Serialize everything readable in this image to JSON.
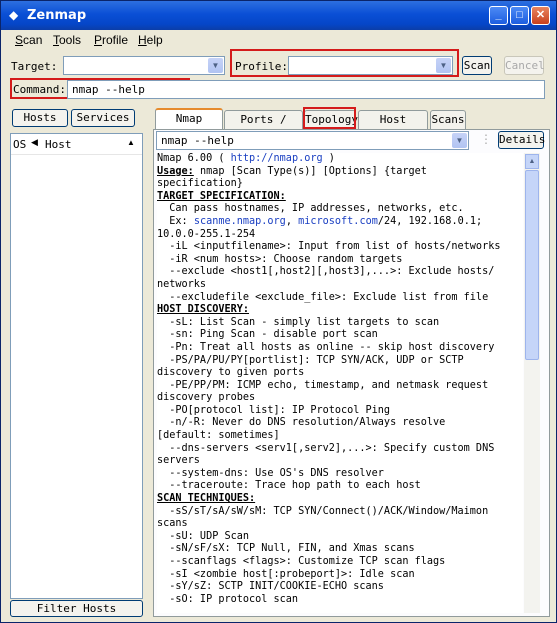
{
  "window": {
    "title": "Zenmap"
  },
  "menu": [
    {
      "label": "Scan",
      "u": "S"
    },
    {
      "label": "Tools",
      "u": "T"
    },
    {
      "label": "Profile",
      "u": "P"
    },
    {
      "label": "Help",
      "u": "H"
    }
  ],
  "toolbar": {
    "target_label": "Target:",
    "target_value": "",
    "profile_label": "Profile:",
    "profile_value": "",
    "scan_label": "Scan",
    "cancel_label": "Cancel",
    "command_label": "Command:",
    "command_value": "nmap --help"
  },
  "left": {
    "hosts_tab": "Hosts",
    "services_tab": "Services",
    "col_os": "OS",
    "col_host": "Host",
    "filter_button": "Filter Hosts"
  },
  "tabs": [
    "Nmap Output",
    "Ports / Hosts",
    "Topology",
    "Host Details",
    "Scans"
  ],
  "output_panel": {
    "selector_value": "nmap --help",
    "details_label": "Details"
  },
  "output_lines": [
    {
      "segs": [
        {
          "t": "Nmap 6.00 ( "
        },
        {
          "t": "http://nmap.org",
          "c": "url"
        },
        {
          "t": " )"
        }
      ]
    },
    {
      "segs": [
        {
          "t": "Usage:",
          "c": "hdr"
        },
        {
          "t": " nmap [Scan Type(s)] [Options] {target"
        }
      ]
    },
    {
      "segs": [
        {
          "t": "specification}"
        }
      ]
    },
    {
      "segs": [
        {
          "t": "TARGET SPECIFICATION:",
          "c": "hdr"
        }
      ]
    },
    {
      "segs": [
        {
          "t": "  Can pass hostnames, IP addresses, networks, etc."
        }
      ]
    },
    {
      "segs": [
        {
          "t": "  Ex: "
        },
        {
          "t": "scanme.nmap.org",
          "c": "url"
        },
        {
          "t": ", "
        },
        {
          "t": "microsoft.com",
          "c": "url"
        },
        {
          "t": "/24, 192.168.0.1;"
        }
      ]
    },
    {
      "segs": [
        {
          "t": "10.0.0-255.1-254"
        }
      ]
    },
    {
      "segs": [
        {
          "t": "  -iL <inputfilename>: Input from list of hosts/networks"
        }
      ]
    },
    {
      "segs": [
        {
          "t": "  -iR <num hosts>: Choose random targets"
        }
      ]
    },
    {
      "segs": [
        {
          "t": "  --exclude <host1[,host2][,host3],...>: Exclude hosts/"
        }
      ]
    },
    {
      "segs": [
        {
          "t": "networks"
        }
      ]
    },
    {
      "segs": [
        {
          "t": "  --excludefile <exclude_file>: Exclude list from file"
        }
      ]
    },
    {
      "segs": [
        {
          "t": "HOST DISCOVERY:",
          "c": "hdr"
        }
      ]
    },
    {
      "segs": [
        {
          "t": "  -sL: List Scan - simply list targets to scan"
        }
      ]
    },
    {
      "segs": [
        {
          "t": "  -sn: Ping Scan - disable port scan"
        }
      ]
    },
    {
      "segs": [
        {
          "t": "  -Pn: Treat all hosts as online -- skip host discovery"
        }
      ]
    },
    {
      "segs": [
        {
          "t": "  -PS/PA/PU/PY[portlist]: TCP SYN/ACK, UDP or SCTP"
        }
      ]
    },
    {
      "segs": [
        {
          "t": "discovery to given ports"
        }
      ]
    },
    {
      "segs": [
        {
          "t": "  -PE/PP/PM: ICMP echo, timestamp, and netmask request"
        }
      ]
    },
    {
      "segs": [
        {
          "t": "discovery probes"
        }
      ]
    },
    {
      "segs": [
        {
          "t": "  -PO[protocol list]: IP Protocol Ping"
        }
      ]
    },
    {
      "segs": [
        {
          "t": "  -n/-R: Never do DNS resolution/Always resolve"
        }
      ]
    },
    {
      "segs": [
        {
          "t": "[default: sometimes]"
        }
      ]
    },
    {
      "segs": [
        {
          "t": "  --dns-servers <serv1[,serv2],...>: Specify custom DNS"
        }
      ]
    },
    {
      "segs": [
        {
          "t": "servers"
        }
      ]
    },
    {
      "segs": [
        {
          "t": "  --system-dns: Use OS's DNS resolver"
        }
      ]
    },
    {
      "segs": [
        {
          "t": "  --traceroute: Trace hop path to each host"
        }
      ]
    },
    {
      "segs": [
        {
          "t": "SCAN TECHNIQUES:",
          "c": "hdr"
        }
      ]
    },
    {
      "segs": [
        {
          "t": "  -sS/sT/sA/sW/sM: TCP SYN/Connect()/ACK/Window/Maimon"
        }
      ]
    },
    {
      "segs": [
        {
          "t": "scans"
        }
      ]
    },
    {
      "segs": [
        {
          "t": "  -sU: UDP Scan"
        }
      ]
    },
    {
      "segs": [
        {
          "t": "  -sN/sF/sX: TCP Null, FIN, and Xmas scans"
        }
      ]
    },
    {
      "segs": [
        {
          "t": "  --scanflags <flags>: Customize TCP scan flags"
        }
      ]
    },
    {
      "segs": [
        {
          "t": "  -sI <zombie host[:probeport]>: Idle scan"
        }
      ]
    },
    {
      "segs": [
        {
          "t": "  -sY/sZ: SCTP INIT/COOKIE-ECHO scans"
        }
      ]
    },
    {
      "segs": [
        {
          "t": "  -sO: IP protocol scan"
        }
      ]
    }
  ],
  "colors": {
    "highlight": "#d41b1b",
    "active_tab": "#e68b2c",
    "link": "#1a3fc2"
  }
}
